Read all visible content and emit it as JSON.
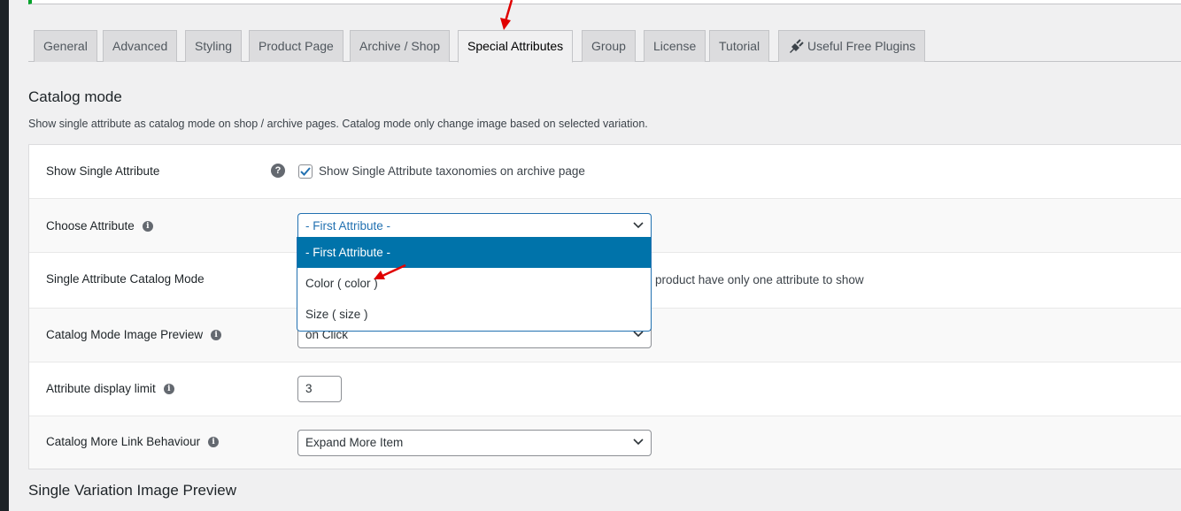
{
  "tabs": [
    {
      "label": "General",
      "active": false
    },
    {
      "label": "Advanced",
      "active": false
    },
    {
      "label": "Styling",
      "active": false
    },
    {
      "label": "Product Page",
      "active": false
    },
    {
      "label": "Archive / Shop",
      "active": false
    },
    {
      "label": "Special Attributes",
      "active": true
    },
    {
      "label": "Group",
      "active": false
    },
    {
      "label": "License",
      "active": false
    },
    {
      "label": "Tutorial",
      "active": false
    },
    {
      "label": "Useful Free Plugins",
      "active": false,
      "icon": "plug-icon"
    }
  ],
  "catalog_mode": {
    "title": "Catalog mode",
    "description": "Show single attribute as catalog mode on shop / archive pages. Catalog mode only change image based on selected variation.",
    "rows": {
      "show_single": {
        "label": "Show Single Attribute",
        "help_icon": "question-icon",
        "checked": true,
        "checkbox_label": "Show Single Attribute taxonomies on archive page"
      },
      "choose_attribute": {
        "label": "Choose Attribute",
        "info_icon": "info-icon",
        "value": "- First Attribute -",
        "options": [
          "- First Attribute -",
          "Color ( color )",
          "Size ( size )"
        ],
        "highlighted_option": "- First Attribute -",
        "open": true
      },
      "catalog_mode": {
        "label": "Single Attribute Catalog Mode",
        "description_visible": "product have only one attribute to show"
      },
      "image_preview": {
        "label": "Catalog Mode Image Preview",
        "info_icon": "info-icon",
        "value": "on Click"
      },
      "display_limit": {
        "label": "Attribute display limit",
        "info_icon": "info-icon",
        "value": "3"
      },
      "more_link": {
        "label": "Catalog More Link Behaviour",
        "info_icon": "info-icon",
        "value": "Expand More Item"
      }
    }
  },
  "next_section": {
    "title": "Single Variation Image Preview"
  },
  "colors": {
    "accent": "#2271b1",
    "option_highlight": "#0073aa",
    "annotation_arrow": "#e00000",
    "notice_border": "#00a32a"
  }
}
